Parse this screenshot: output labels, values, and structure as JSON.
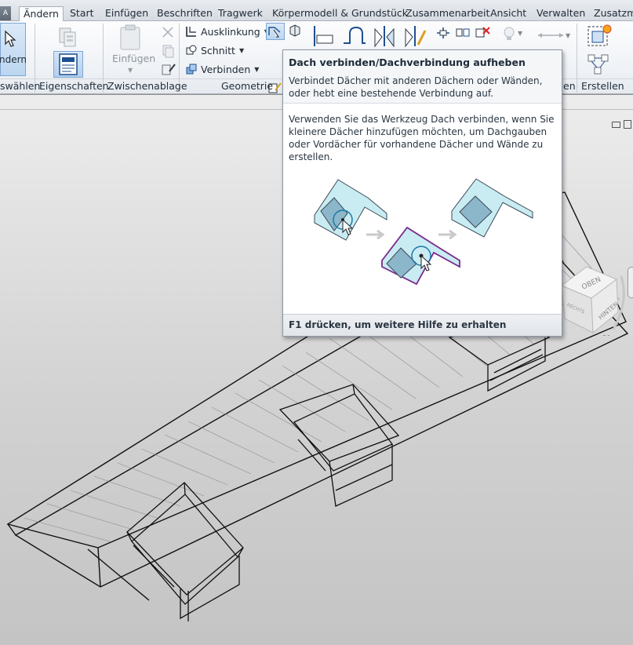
{
  "ribbon_tabs": {
    "app_corner": "A",
    "items": [
      "Ändern",
      "Start",
      "Einfügen",
      "Beschriften",
      "Tragwerk",
      "Körpermodell & Grundstück",
      "Zusammenarbeit",
      "Ansicht",
      "Verwalten",
      "Zusatzmo"
    ],
    "active": "Ändern"
  },
  "ribbon": {
    "select_button_label": "ndern",
    "paste_label": "Einfügen",
    "geometry_tools": {
      "cope": "Ausklinkung",
      "cut": "Schnitt",
      "join": "Verbinden"
    },
    "panels": {
      "select": "swählen",
      "properties": "Eigenschaften",
      "clipboard": "Zwischenablage",
      "geometry": "Geometrie",
      "hidden_partial": "en",
      "create": "Erstellen"
    }
  },
  "tooltip": {
    "title": "Dach verbinden/Dachverbindung aufheben",
    "description": "Verbindet Dächer mit anderen Dächern oder Wänden, oder hebt eine bestehende Verbindung auf.",
    "detail": "Verwenden Sie das Werkzeug Dach verbinden, wenn Sie kleinere Dächer hinzufügen möchten, um Dachgauben oder Vordächer für vorhandene Dächer und Wände zu erstellen.",
    "footer": "F1 drücken, um weitere Hilfe zu erhalten"
  },
  "viewcube": {
    "top_face": "OBEN",
    "left_face": "RECHTS",
    "right_face": "HINTEN",
    "compass_north": "N"
  },
  "colors": {
    "ribbon_selected": "#bcd6f1",
    "tooltip_border": "#8e98a4",
    "illustration_highlight": "#7a2a8c",
    "illustration_roof": "#c9ecf3"
  }
}
